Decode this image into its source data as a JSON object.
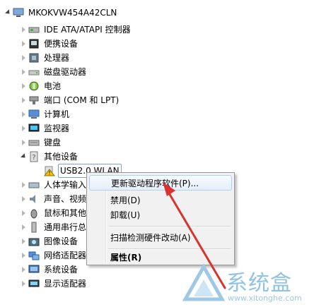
{
  "tree": {
    "root": "MKOKVW454A42CLN",
    "items": [
      {
        "label": "IDE ATA/ATAPI 控制器",
        "icon": "ide-controller-icon"
      },
      {
        "label": "便携设备",
        "icon": "portable-device-icon"
      },
      {
        "label": "处理器",
        "icon": "processor-icon"
      },
      {
        "label": "磁盘驱动器",
        "icon": "disk-drive-icon"
      },
      {
        "label": "电池",
        "icon": "battery-icon"
      },
      {
        "label": "端口 (COM 和 LPT)",
        "icon": "port-icon"
      },
      {
        "label": "计算机",
        "icon": "computer-icon"
      },
      {
        "label": "监视器",
        "icon": "monitor-icon"
      },
      {
        "label": "键盘",
        "icon": "keyboard-icon"
      },
      {
        "label": "其他设备",
        "icon": "other-devices-icon"
      },
      {
        "label": "USB2.0 WLAN",
        "icon": "unknown-device-warning-icon"
      },
      {
        "label": "人体学输入",
        "icon": "hid-icon"
      },
      {
        "label": "声音、视频",
        "icon": "sound-icon"
      },
      {
        "label": "鼠标和其他",
        "icon": "mouse-icon"
      },
      {
        "label": "通用串行总",
        "icon": "usb-icon"
      },
      {
        "label": "图像设备",
        "icon": "imaging-device-icon"
      },
      {
        "label": "网络适配器",
        "icon": "network-adapter-icon"
      },
      {
        "label": "系统设备",
        "icon": "system-device-icon"
      },
      {
        "label": "显示适配器",
        "icon": "display-adapter-icon"
      }
    ]
  },
  "menu": {
    "update_driver": "更新驱动程序软件(P)...",
    "disable": "禁用(D)",
    "uninstall": "卸载(U)",
    "scan": "扫描检测硬件改动(A)",
    "properties": "属性(R)"
  },
  "watermark": {
    "text": "系统盒",
    "url": "www.xitonghe.com"
  },
  "colors": {
    "menu_bg": "#f1f1f1",
    "highlight_border": "#aecff7",
    "arrow": "#d9322f",
    "watermark": "#8ec3e6"
  }
}
